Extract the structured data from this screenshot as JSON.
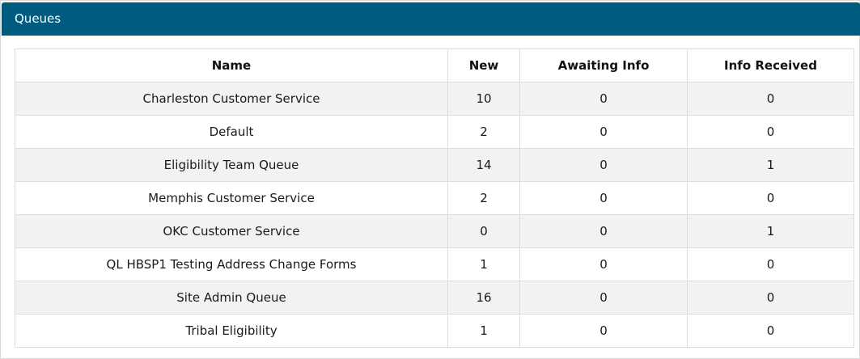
{
  "panel": {
    "title": "Queues"
  },
  "table": {
    "columns": [
      "Name",
      "New",
      "Awaiting Info",
      "Info Received"
    ],
    "rows": [
      [
        "Charleston Customer Service",
        "10",
        "0",
        "0"
      ],
      [
        "Default",
        "2",
        "0",
        "0"
      ],
      [
        "Eligibility Team Queue",
        "14",
        "0",
        "1"
      ],
      [
        "Memphis Customer Service",
        "2",
        "0",
        "0"
      ],
      [
        "OKC Customer Service",
        "0",
        "0",
        "1"
      ],
      [
        "QL HBSP1 Testing Address Change Forms",
        "1",
        "0",
        "0"
      ],
      [
        "Site Admin Queue",
        "16",
        "0",
        "0"
      ],
      [
        "Tribal Eligibility",
        "1",
        "0",
        "0"
      ]
    ]
  },
  "colors": {
    "header_bg": "#005b7f",
    "stripe_bg": "#f2f2f2"
  }
}
